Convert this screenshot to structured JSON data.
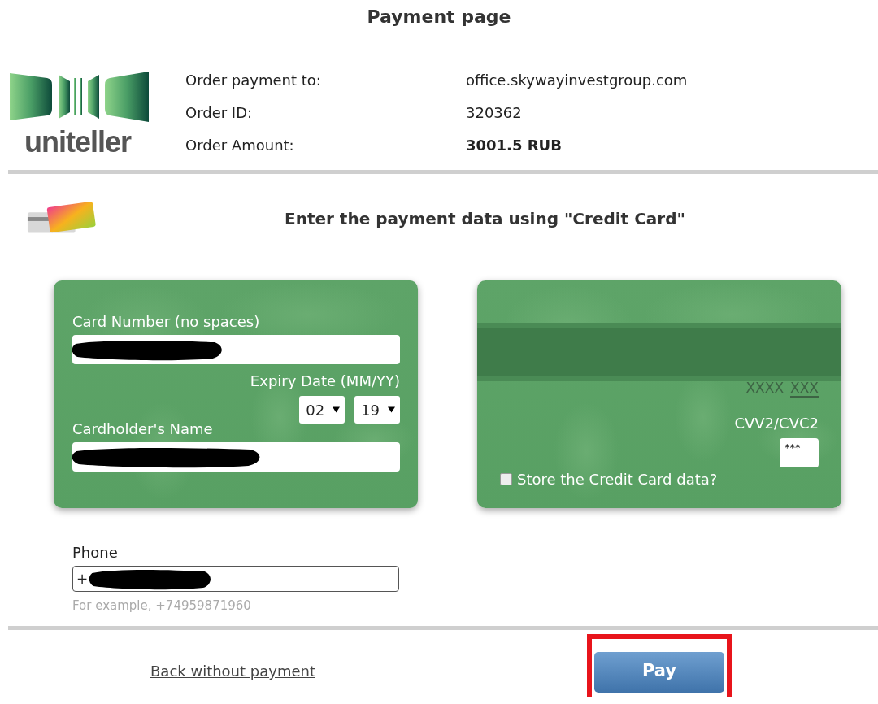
{
  "page_title": "Payment page",
  "logo": {
    "wordmark": "uniteller"
  },
  "order": [
    {
      "label": "Order payment to:",
      "value": "office.skywayinvestgroup.com",
      "bold": false
    },
    {
      "label": "Order ID:",
      "value": "320362",
      "bold": false
    },
    {
      "label": "Order Amount:",
      "value": "3001.5 RUB",
      "bold": true
    }
  ],
  "method_heading": "Enter the payment data using \"Credit Card\"",
  "card_front": {
    "card_number_label": "Card Number (no spaces)",
    "card_number_redacted": true,
    "expiry_label": "Expiry Date (MM/YY)",
    "expiry_month": "02",
    "expiry_year": "19",
    "name_label": "Cardholder's Name",
    "name_redacted": true
  },
  "card_back": {
    "code_prefix": "XXXX",
    "code_suffix": "XXX",
    "cvv_label": "CVV2/CVC2",
    "cvv_value": "***",
    "store_label": "Store the Credit Card data?",
    "store_checked": false
  },
  "phone": {
    "label": "Phone",
    "value": "+",
    "redacted": true,
    "hint": "For example, +74959871960"
  },
  "back_link": "Back without payment",
  "pay_button": {
    "label": "Pay",
    "highlighted": true
  }
}
